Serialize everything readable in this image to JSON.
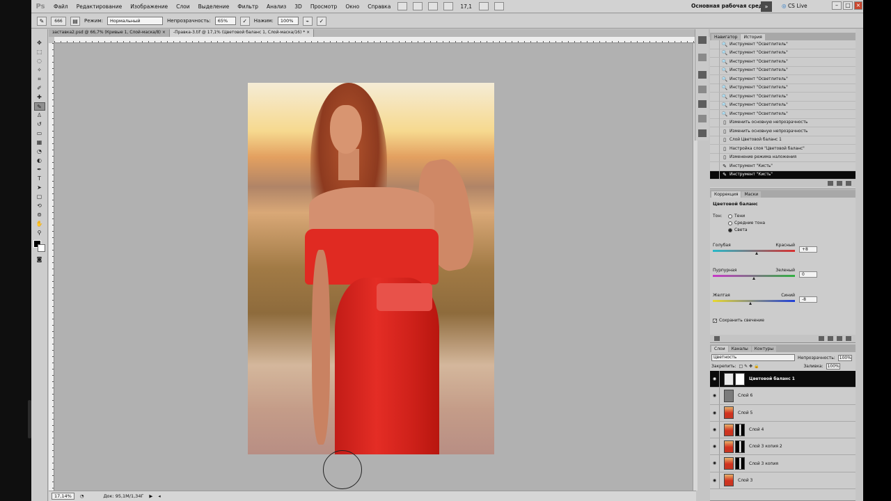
{
  "app": {
    "logo": "Ps"
  },
  "menu": [
    "Файл",
    "Редактирование",
    "Изображение",
    "Слои",
    "Выделение",
    "Фильтр",
    "Анализ",
    "3D",
    "Просмотр",
    "Окно",
    "Справка"
  ],
  "menubar": {
    "zoom": "17,1",
    "workspace": "Основная рабочая среда",
    "cslive": "CS Live"
  },
  "options": {
    "brush_size": "666",
    "mode_label": "Режим:",
    "mode_value": "Нормальный",
    "opacity_label": "Непрозрачность:",
    "opacity_value": "65%",
    "flow_label": "Нажим:",
    "flow_value": "100%"
  },
  "doc_tabs": [
    {
      "label": "заставка2.psd @ 66,7% (Кривые 1, Слой-маска/8)"
    },
    {
      "label": "-Правка-3.tif @ 17,1% (Цветовой баланс 1, Слой-маска/16) *"
    }
  ],
  "ruler_top": [
    "2",
    "4",
    "6",
    "8",
    "10",
    "12",
    "14",
    "16",
    "18",
    "20",
    "22",
    "24",
    "26",
    "28",
    "30",
    "32",
    "34",
    "36",
    "38",
    "40",
    "42",
    "44",
    "46",
    "48",
    "50",
    "52",
    "54",
    "56"
  ],
  "status": {
    "zoom": "17,14%",
    "doc": "Док: 95,1M/1,34Г"
  },
  "history": {
    "tabs": [
      "Навигатор",
      "История"
    ],
    "items": [
      "Инструмент \"Осветлитель\"",
      "Инструмент \"Осветлитель\"",
      "Инструмент \"Осветлитель\"",
      "Инструмент \"Осветлитель\"",
      "Инструмент \"Осветлитель\"",
      "Инструмент \"Осветлитель\"",
      "Инструмент \"Осветлитель\"",
      "Инструмент \"Осветлитель\"",
      "Инструмент \"Осветлитель\"",
      "Изменить основную непрозрачность",
      "Изменить основную непрозрачность",
      "Слой Цветовой баланс 1",
      "Настройка слоя \"Цветовой баланс\"",
      "Изменение режима наложения",
      "Инструмент \"Кисть\"",
      "Инструмент \"Кисть\""
    ]
  },
  "adjust": {
    "tabs": [
      "Коррекция",
      "Маски"
    ],
    "title": "Цветовой баланс",
    "tone_label": "Тон:",
    "tones": [
      "Тени",
      "Средние тона",
      "Света"
    ],
    "sliders": [
      {
        "left": "Голубая",
        "right": "Красный",
        "value": "+8",
        "position": 0.54,
        "gradient": "#28b8c8,#d83030"
      },
      {
        "left": "Пурпурная",
        "right": "Зеленый",
        "value": "0",
        "position": 0.5,
        "gradient": "#c838c8,#30b040"
      },
      {
        "left": "Желтая",
        "right": "Синий",
        "value": "-8",
        "position": 0.46,
        "gradient": "#e8d830,#2040d8"
      }
    ],
    "preserve": "Сохранить свечение"
  },
  "layers": {
    "tabs": [
      "Слои",
      "Каналы",
      "Контуры"
    ],
    "blend": "Цветность",
    "opacity_label": "Непрозрачность:",
    "opacity": "100%",
    "lock_label": "Закрепить:",
    "fill_label": "Заливка:",
    "fill": "100%",
    "items": [
      {
        "name": "Цветовой баланс 1",
        "kind": "adj"
      },
      {
        "name": "Слой 6",
        "kind": "gray"
      },
      {
        "name": "Слой 5",
        "kind": "photo"
      },
      {
        "name": "Слой 4",
        "kind": "mask"
      },
      {
        "name": "Слой 3 копия 2",
        "kind": "mask"
      },
      {
        "name": "Слой 3 копия",
        "kind": "mask"
      },
      {
        "name": "Слой 3",
        "kind": "photo"
      }
    ]
  }
}
